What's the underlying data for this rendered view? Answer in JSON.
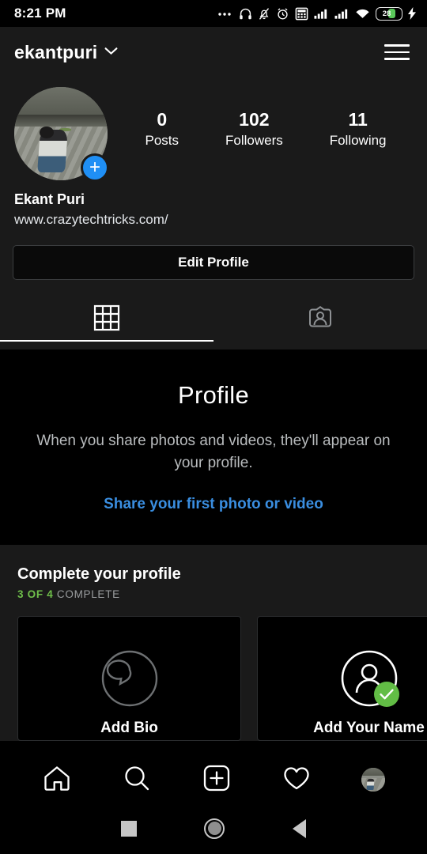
{
  "status_bar": {
    "time": "8:21 PM",
    "icons": [
      "more-dots-icon",
      "headphones-icon",
      "bell-muted-icon",
      "alarm-clock-icon",
      "calculator-icon",
      "signal-bars-1-icon",
      "signal-bars-2-icon",
      "wifi-icon"
    ],
    "battery_percent": "28"
  },
  "header": {
    "username": "ekantpuri",
    "chevron": "chevron-down-icon",
    "menu": "hamburger-menu-icon"
  },
  "profile": {
    "avatar_alt": "profile-photo",
    "add_story_badge": "+",
    "stats": [
      {
        "num": "0",
        "label": "Posts"
      },
      {
        "num": "102",
        "label": "Followers"
      },
      {
        "num": "11",
        "label": "Following"
      }
    ],
    "full_name": "Ekant Puri",
    "website": "www.crazytechtricks.com/",
    "edit_button": "Edit Profile"
  },
  "tabs": [
    {
      "name": "grid-tab",
      "icon": "grid-icon",
      "active": true
    },
    {
      "name": "tagged-tab",
      "icon": "tagged-person-icon",
      "active": false
    }
  ],
  "empty_state": {
    "title": "Profile",
    "body": "When you share photos and videos, they'll appear on your profile.",
    "cta": "Share your first photo or video",
    "cta_color": "#3a8ee0"
  },
  "complete_profile": {
    "title": "Complete your profile",
    "progress_count": "3 OF 4",
    "progress_word": "COMPLETE",
    "progress_color": "#6fbf4b",
    "cards": [
      {
        "label": "Add Bio",
        "icon": "speech-bubble-icon",
        "done": false
      },
      {
        "label": "Add Your Name",
        "icon": "person-icon",
        "done": true
      }
    ]
  },
  "bottom_nav": [
    {
      "name": "home",
      "icon": "home-icon"
    },
    {
      "name": "search",
      "icon": "search-icon"
    },
    {
      "name": "create",
      "icon": "plus-square-icon"
    },
    {
      "name": "activity",
      "icon": "heart-icon"
    },
    {
      "name": "profile",
      "icon": "profile-avatar-icon"
    }
  ],
  "android_nav": [
    {
      "name": "recents",
      "icon": "square-icon"
    },
    {
      "name": "home",
      "icon": "circle-icon"
    },
    {
      "name": "back",
      "icon": "triangle-back-icon"
    }
  ]
}
